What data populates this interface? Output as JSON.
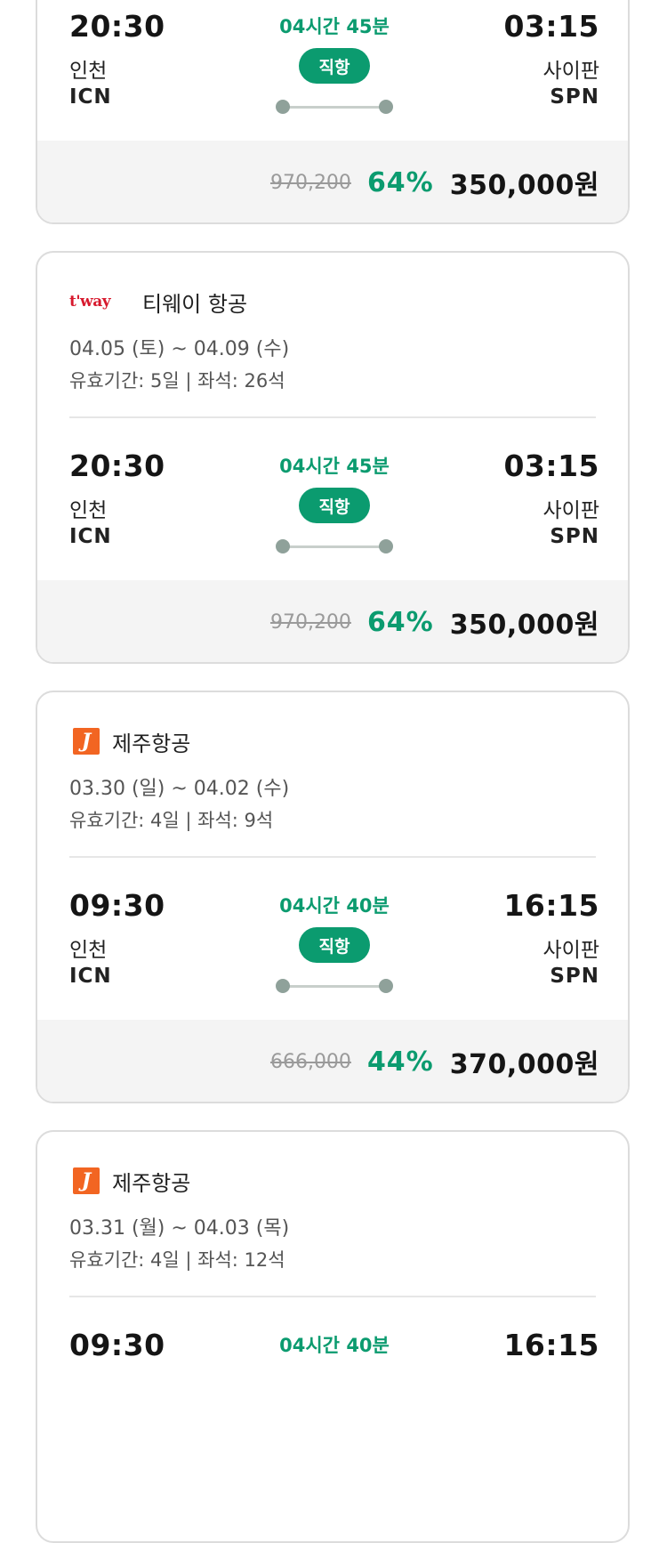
{
  "cards": [
    {
      "airline": null,
      "flight": {
        "dep_time": "20:30",
        "dep_city": "인천",
        "dep_code": "ICN",
        "arr_time": "03:15",
        "arr_city": "사이판",
        "arr_code": "SPN",
        "duration": "04시간 45분",
        "type": "직항"
      },
      "price": {
        "original": "970,200",
        "discount": "64%",
        "final": "350,000원"
      }
    },
    {
      "airline": {
        "name": "티웨이 항공",
        "logo_text": "t'way",
        "logo_icon": "tway-logo-icon"
      },
      "dates": "04.05 (토) ~ 04.09 (수)",
      "info": "유효기간: 5일 | 좌석: 26석",
      "flight": {
        "dep_time": "20:30",
        "dep_city": "인천",
        "dep_code": "ICN",
        "arr_time": "03:15",
        "arr_city": "사이판",
        "arr_code": "SPN",
        "duration": "04시간 45분",
        "type": "직항"
      },
      "price": {
        "original": "970,200",
        "discount": "64%",
        "final": "350,000원"
      }
    },
    {
      "airline": {
        "name": "제주항공",
        "logo_text": "J",
        "logo_icon": "jejuair-logo-icon"
      },
      "dates": "03.30 (일) ~ 04.02 (수)",
      "info": "유효기간: 4일 | 좌석: 9석",
      "flight": {
        "dep_time": "09:30",
        "dep_city": "인천",
        "dep_code": "ICN",
        "arr_time": "16:15",
        "arr_city": "사이판",
        "arr_code": "SPN",
        "duration": "04시간 40분",
        "type": "직항"
      },
      "price": {
        "original": "666,000",
        "discount": "44%",
        "final": "370,000원"
      }
    },
    {
      "airline": {
        "name": "제주항공",
        "logo_text": "J",
        "logo_icon": "jejuair-logo-icon"
      },
      "dates": "03.31 (월) ~ 04.03 (목)",
      "info": "유효기간: 4일 | 좌석: 12석",
      "flight": {
        "dep_time": "09:30",
        "dep_city": "",
        "dep_code": "",
        "arr_time": "16:15",
        "arr_city": "",
        "arr_code": "",
        "duration": "04시간 40분",
        "type": ""
      },
      "price": null
    }
  ],
  "colors": {
    "accent": "#0b9b6f",
    "tway_red": "#d7192d",
    "jeju_orange": "#f26522",
    "price_bg": "#f4f4f4"
  }
}
